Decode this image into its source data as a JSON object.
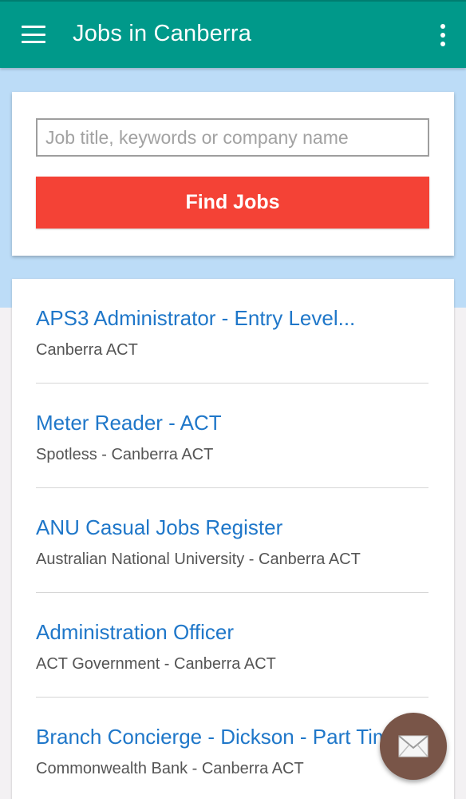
{
  "app_bar": {
    "title": "Jobs in Canberra",
    "menu_icon": "hamburger-menu-icon",
    "more_icon": "more-vertical-icon",
    "color": "#00998a"
  },
  "search": {
    "placeholder": "Job title, keywords or company name",
    "value": "",
    "button_label": "Find Jobs",
    "button_color": "#f44236"
  },
  "jobs": [
    {
      "title": "APS3 Administrator - Entry Level...",
      "subtitle": "Canberra ACT"
    },
    {
      "title": "Meter Reader - ACT",
      "subtitle": "Spotless - Canberra ACT"
    },
    {
      "title": "ANU Casual Jobs Register",
      "subtitle": "Australian National University - Canberra ACT"
    },
    {
      "title": "Administration Officer",
      "subtitle": "ACT Government - Canberra ACT"
    },
    {
      "title": "Branch Concierge - Dickson - Part Time",
      "subtitle": "Commonwealth Bank - Canberra ACT"
    }
  ],
  "fab": {
    "icon": "envelope-icon",
    "color": "#795548"
  }
}
